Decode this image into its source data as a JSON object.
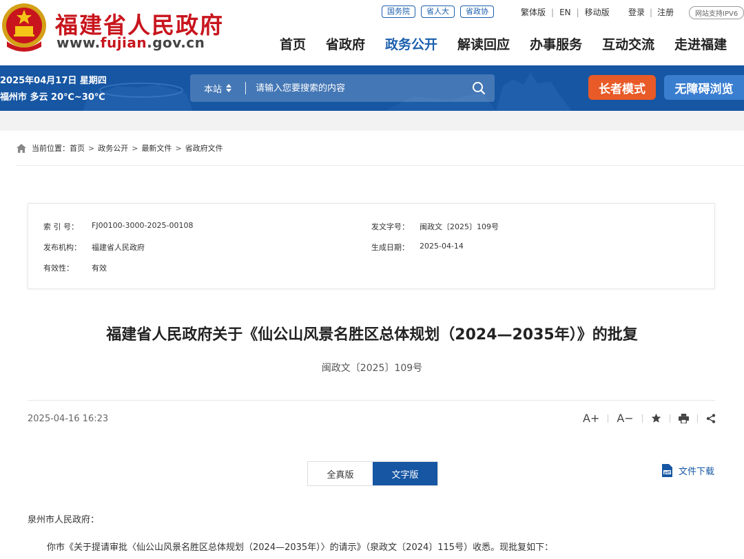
{
  "header": {
    "site_name": "福建省人民政府",
    "domain_prefix": "www.",
    "domain_hl": "fujian",
    "domain_suffix": ".gov.cn",
    "tags": [
      "国务院",
      "省人大",
      "省政协"
    ],
    "util_links": [
      "繁体版",
      "EN",
      "移动版"
    ],
    "acct_links": [
      "登录",
      "注册"
    ],
    "ipv6_badge": "网站支持IPV6",
    "nav": [
      "首页",
      "省政府",
      "政务公开",
      "解读回应",
      "办事服务",
      "互动交流",
      "走进福建"
    ],
    "nav_active_index": 2
  },
  "banner": {
    "date": "2025年04月17日 星期四",
    "weather": "福州市 多云 20℃~30℃",
    "search_scope": "本站",
    "search_placeholder": "请输入您要搜索的内容",
    "elder_mode": "长者模式",
    "accessibility": "无障碍浏览"
  },
  "breadcrumb": {
    "label": "当前位置：",
    "items": [
      "首页",
      "政务公开",
      "最新文件",
      "省政府文件"
    ]
  },
  "info": {
    "index_no_label": "索 引 号：",
    "index_no": "FJ00100-3000-2025-00108",
    "doc_no_label": "发文字号：",
    "doc_no": "闽政文〔2025〕109号",
    "issuer_label": "发布机构：",
    "issuer": "福建省人民政府",
    "date_label": "生成日期：",
    "date": "2025-04-14",
    "validity_label": "有效性：",
    "validity": "有效"
  },
  "article": {
    "title": "福建省人民政府关于《仙公山风景名胜区总体规划（2024—2035年）》的批复",
    "doc_no": "闽政文〔2025〕109号",
    "published": "2025-04-16 16:23",
    "tools": {
      "font_up": "A+",
      "font_down": "A−"
    },
    "version_tabs": [
      "全真版",
      "文字版"
    ],
    "version_active_index": 1,
    "download": "文件下载",
    "salutation": "泉州市人民政府：",
    "para1": "你市《关于提请审批〈仙公山风景名胜区总体规划（2024—2035年）〉的请示》（泉政文〔2024〕115号）收悉。现批复如下："
  },
  "colors": {
    "brand_red": "#c8151d",
    "brand_blue": "#1656a3",
    "elder_orange": "#e85a27",
    "access_blue": "#3a7ed0"
  }
}
